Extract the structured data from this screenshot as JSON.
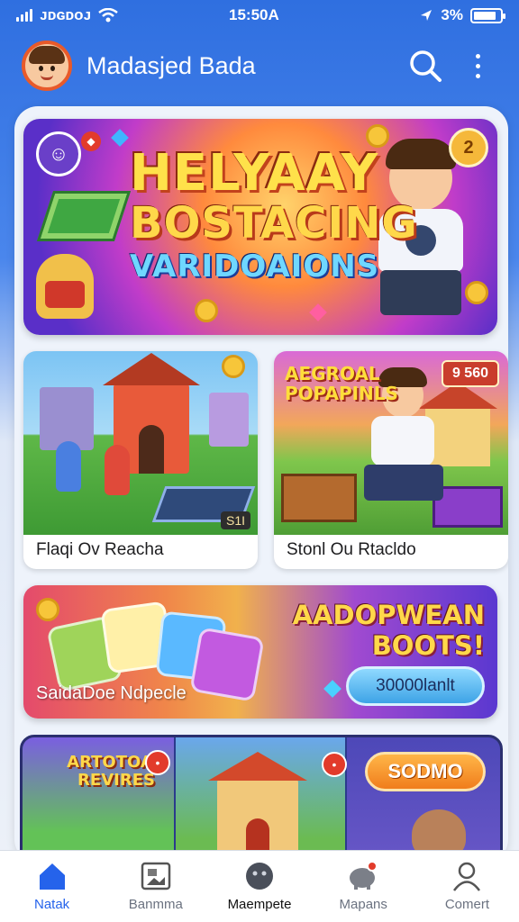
{
  "status_bar": {
    "carrier": "ᴊᴅɢᴅᴏᴊ",
    "time": "15:50A",
    "battery_text": "3%",
    "battery_level": 0.85
  },
  "header": {
    "title": "Madasjed Bada"
  },
  "hero": {
    "line1": "HELYAAY",
    "line2": "BOSTACING",
    "line3": "VARIDOAIONS",
    "coin_badge": "2"
  },
  "tiles": [
    {
      "caption": "Flaqi Ov Reacha",
      "corner_label": "S1I"
    },
    {
      "caption": "Stonl Ou Rtacldo",
      "tag": "AEGROAL POPAPINLS",
      "price": "9 560"
    }
  ],
  "promo": {
    "headline_1": "AADOPWEAN",
    "headline_2": "BOOTS!",
    "subtitle": "SaidaDoe Ndpecle",
    "cta": "30000lanlt"
  },
  "strip": {
    "title": "ARTOTOAU REVIRES",
    "button": "SODMO"
  },
  "bottom_nav": [
    {
      "label": "Natak",
      "icon": "home-icon",
      "active": true
    },
    {
      "label": "Banmma",
      "icon": "gallery-icon",
      "active": false
    },
    {
      "label": "Maempete",
      "icon": "game-icon",
      "active": false
    },
    {
      "label": "Mapans",
      "icon": "piggy-icon",
      "active": false
    },
    {
      "label": "Comert",
      "icon": "profile-icon",
      "active": false
    }
  ],
  "colors": {
    "primary": "#2f6fe0",
    "nav_active": "#2563eb",
    "badge_red": "#e23b2b"
  }
}
